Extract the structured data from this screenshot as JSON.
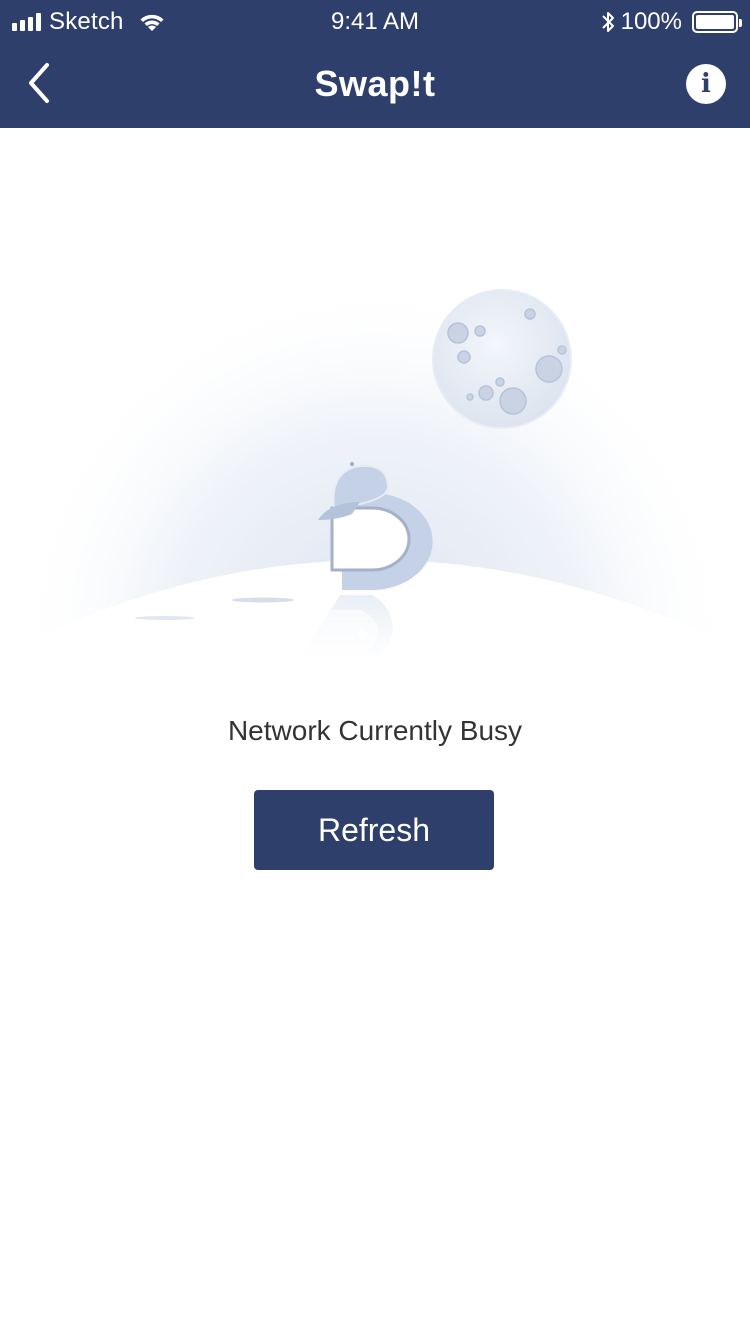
{
  "status_bar": {
    "carrier": "Sketch",
    "time": "9:41 AM",
    "battery_percent": "100%",
    "icons": [
      "signal-icon",
      "wifi-icon",
      "bluetooth-icon",
      "battery-icon"
    ]
  },
  "nav": {
    "title": "Swap!t",
    "back_icon": "chevron-left-icon",
    "info_icon": "info-icon",
    "info_glyph": "i"
  },
  "content": {
    "illustration": "network-busy-illustration",
    "message": "Network Currently Busy",
    "refresh_label": "Refresh"
  },
  "colors": {
    "header_bg": "#2f3f6c",
    "button_bg": "#2f3f6c",
    "text": "#333333",
    "illustration_blue": "#c5d1e6"
  }
}
